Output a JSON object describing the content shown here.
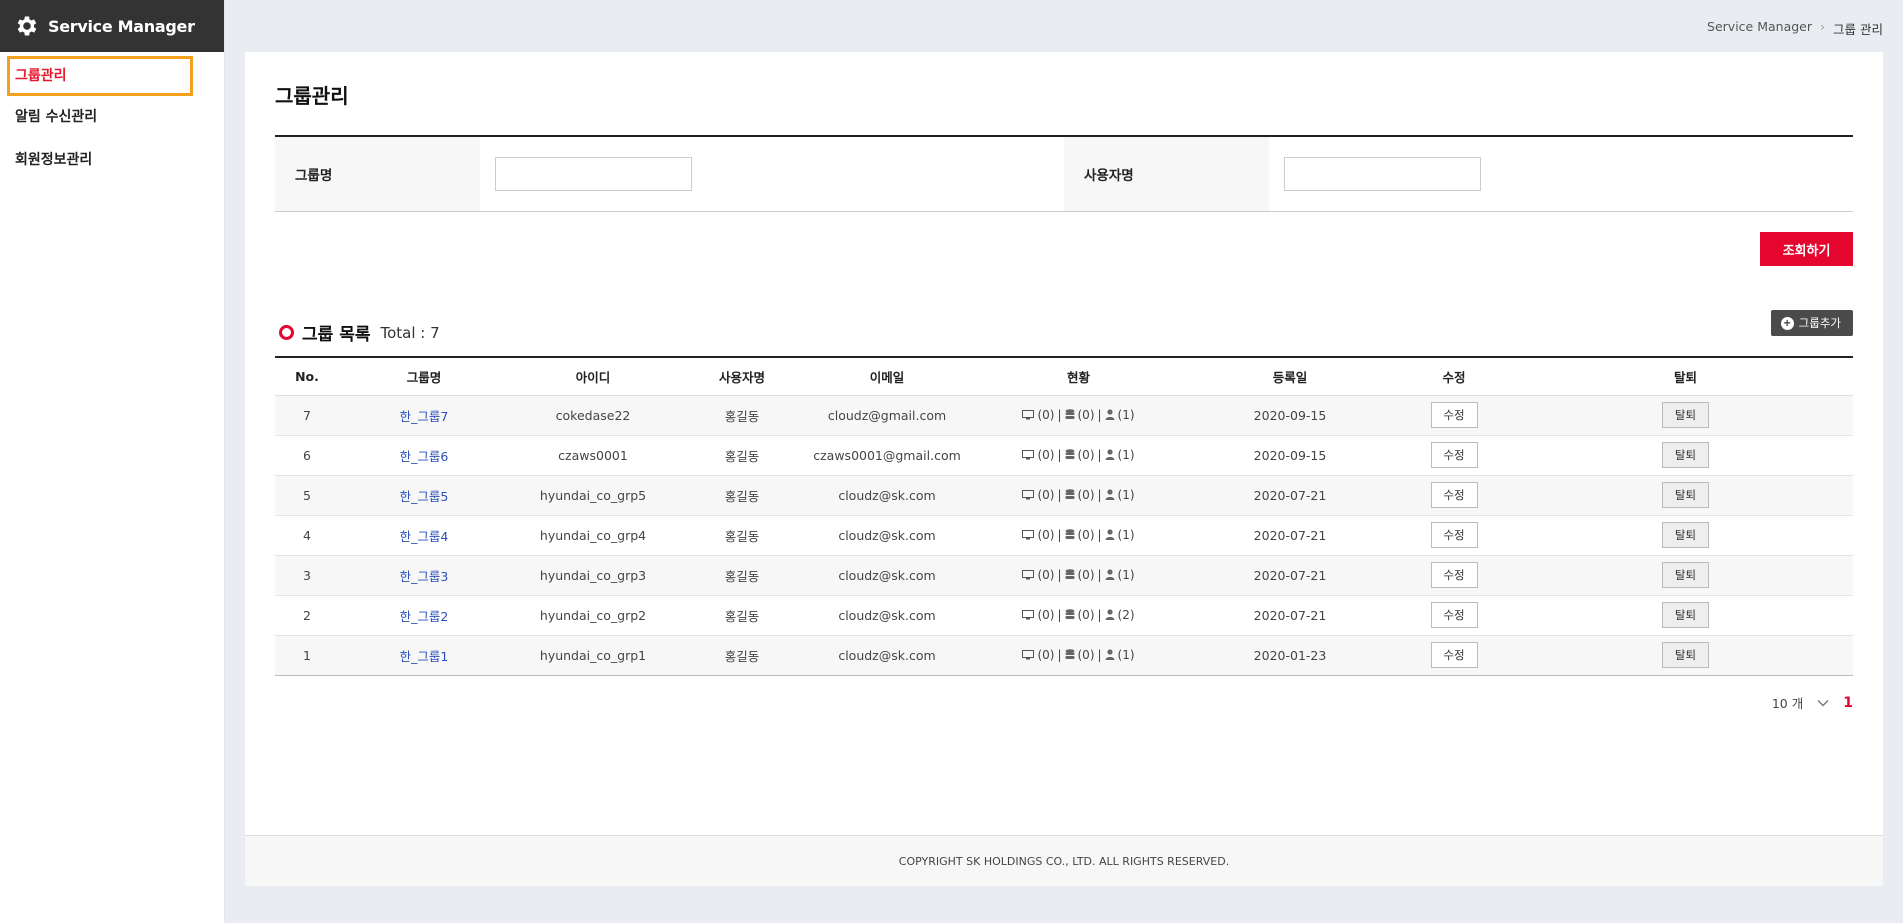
{
  "app": {
    "title": "Service Manager"
  },
  "sidebar": {
    "items": [
      {
        "label": "그룹관리",
        "active": true
      },
      {
        "label": "알림 수신관리"
      },
      {
        "label": "회원정보관리"
      }
    ]
  },
  "breadcrumb": {
    "root": "Service Manager",
    "separator": "›",
    "current": "그룹 관리"
  },
  "page": {
    "title": "그룹관리"
  },
  "search": {
    "group_label": "그룹명",
    "group_value": "",
    "user_label": "사용자명",
    "user_value": "",
    "submit_label": "조회하기"
  },
  "list": {
    "title": "그룹 목록",
    "total": "Total : 7",
    "add_label": "그룹추가",
    "columns": [
      "No.",
      "그룹명",
      "아이디",
      "사용자명",
      "이메일",
      "현황",
      "등록일",
      "수정",
      "탈퇴"
    ],
    "rows": [
      {
        "no": "7",
        "group": "한_그룹7",
        "id": "cokedase22",
        "user": "홍길동",
        "email": "cloudz@gmail.com",
        "vm": "(0)",
        "db": "(0)",
        "members": "(1)",
        "date": "2020-09-15",
        "edit": "수정",
        "leave": "탈퇴"
      },
      {
        "no": "6",
        "group": "한_그룹6",
        "id": "czaws0001",
        "user": "홍길동",
        "email": "czaws0001@gmail.com",
        "vm": "(0)",
        "db": "(0)",
        "members": "(1)",
        "date": "2020-09-15",
        "edit": "수정",
        "leave": "탈퇴"
      },
      {
        "no": "5",
        "group": "한_그룹5",
        "id": "hyundai_co_grp5",
        "user": "홍길동",
        "email": "cloudz@sk.com",
        "vm": "(0)",
        "db": "(0)",
        "members": "(1)",
        "date": "2020-07-21",
        "edit": "수정",
        "leave": "탈퇴"
      },
      {
        "no": "4",
        "group": "한_그룹4",
        "id": "hyundai_co_grp4",
        "user": "홍길동",
        "email": "cloudz@sk.com",
        "vm": "(0)",
        "db": "(0)",
        "members": "(1)",
        "date": "2020-07-21",
        "edit": "수정",
        "leave": "탈퇴"
      },
      {
        "no": "3",
        "group": "한_그룹3",
        "id": "hyundai_co_grp3",
        "user": "홍길동",
        "email": "cloudz@sk.com",
        "vm": "(0)",
        "db": "(0)",
        "members": "(1)",
        "date": "2020-07-21",
        "edit": "수정",
        "leave": "탈퇴"
      },
      {
        "no": "2",
        "group": "한_그룹2",
        "id": "hyundai_co_grp2",
        "user": "홍길동",
        "email": "cloudz@sk.com",
        "vm": "(0)",
        "db": "(0)",
        "members": "(2)",
        "date": "2020-07-21",
        "edit": "수정",
        "leave": "탈퇴"
      },
      {
        "no": "1",
        "group": "한_그룹1",
        "id": "hyundai_co_grp1",
        "user": "홍길동",
        "email": "cloudz@sk.com",
        "vm": "(0)",
        "db": "(0)",
        "members": "(1)",
        "date": "2020-01-23",
        "edit": "수정",
        "leave": "탈퇴"
      }
    ]
  },
  "pagination": {
    "page_size": "10 개",
    "current_page": "1"
  },
  "footer": {
    "copyright": "COPYRIGHT SK HOLDINGS CO., LTD. ALL RIGHTS RESERVED."
  },
  "icons": {
    "brand": "gear-icon",
    "vm": "monitor-icon",
    "db": "database-icon",
    "members": "user-icon",
    "add": "plus-circle-icon",
    "page_size": "chevron-down-icon"
  },
  "colors": {
    "accent": "#e5062f",
    "sidebar_header": "#333333",
    "active_outline": "#f5a01a",
    "link": "#2b4fb8"
  }
}
